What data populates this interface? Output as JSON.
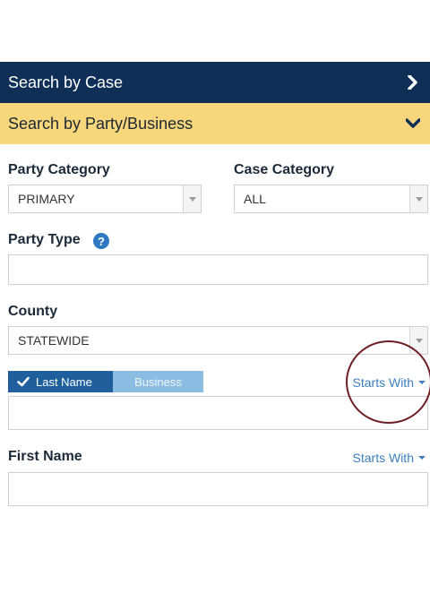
{
  "search_by_case": {
    "label": "Search by Case",
    "icon": "chevron-right-icon"
  },
  "search_by_party": {
    "label": "Search by Party/Business",
    "icon": "chevron-down-icon"
  },
  "party_category": {
    "label": "Party Category",
    "value": "PRIMARY"
  },
  "case_category": {
    "label": "Case Category",
    "value": "ALL"
  },
  "party_type": {
    "label": "Party Type",
    "help": "?",
    "value": ""
  },
  "county": {
    "label": "County",
    "value": "STATEWIDE"
  },
  "name_toggle": {
    "last_name": "Last Name",
    "business": "Business",
    "selected": "Last Name"
  },
  "last_name": {
    "match_mode": "Starts With",
    "value": ""
  },
  "first_name": {
    "label": "First Name",
    "match_mode": "Starts With",
    "value": ""
  },
  "colors": {
    "navy_bar": "#0f2f57",
    "yellow_bar": "#f8d67c",
    "toggle_active": "#1f5f9c",
    "toggle_inactive": "#8bbde2",
    "link": "#3d7fc0",
    "annotation_circle": "#6e1f25"
  }
}
